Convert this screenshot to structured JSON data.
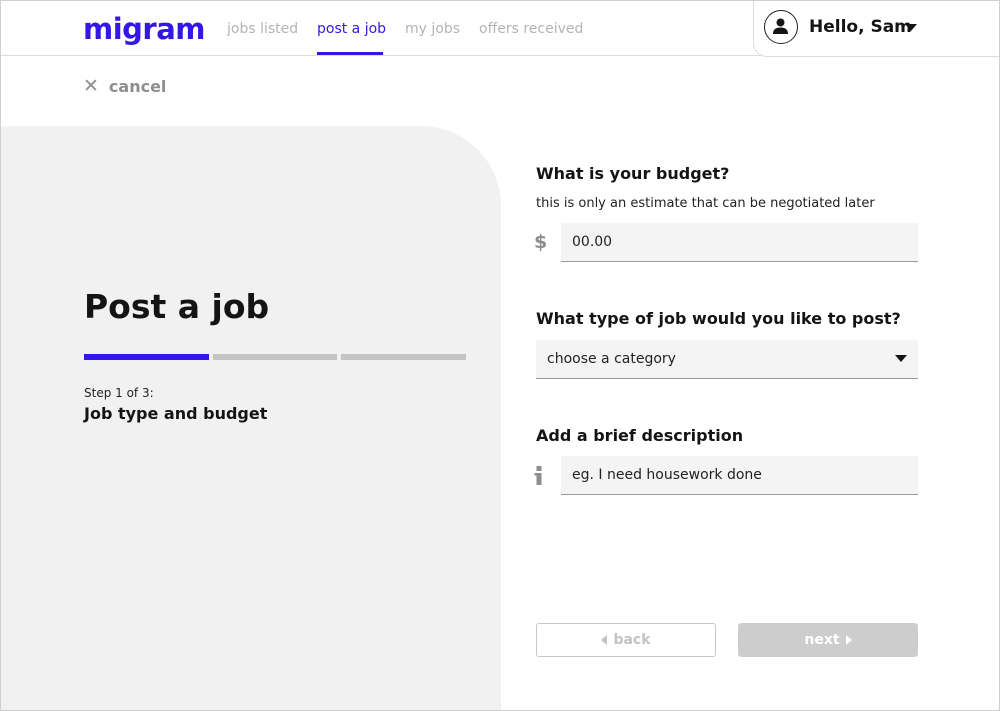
{
  "brand": {
    "logo_text": "migram",
    "accent_color": "#3416e8"
  },
  "nav": {
    "items": [
      {
        "label": "jobs listed",
        "active": false
      },
      {
        "label": "post a job",
        "active": true
      },
      {
        "label": "my jobs",
        "active": false
      },
      {
        "label": "offers received",
        "active": false
      }
    ]
  },
  "user": {
    "greeting": "Hello, Sam",
    "avatar_icon": "user-icon",
    "menu_icon": "caret-down-icon"
  },
  "cancel": {
    "label": "cancel",
    "icon": "close-icon"
  },
  "intro": {
    "title": "Post a job",
    "progress": {
      "current_step": 1,
      "total_steps": 3
    },
    "step_label": "Step 1 of 3:",
    "step_title": "Job type and budget"
  },
  "form": {
    "budget": {
      "question": "What is your budget?",
      "hint": "this is only an estimate that can be negotiated later",
      "currency_symbol": "$",
      "placeholder": "00.00"
    },
    "job_type": {
      "question": "What type of job would you like to post?",
      "selected": "choose a category"
    },
    "description": {
      "question": "Add a brief description",
      "info_icon": "info-icon",
      "placeholder": "eg. I need housework done"
    }
  },
  "buttons": {
    "back_label": "back",
    "next_label": "next"
  }
}
